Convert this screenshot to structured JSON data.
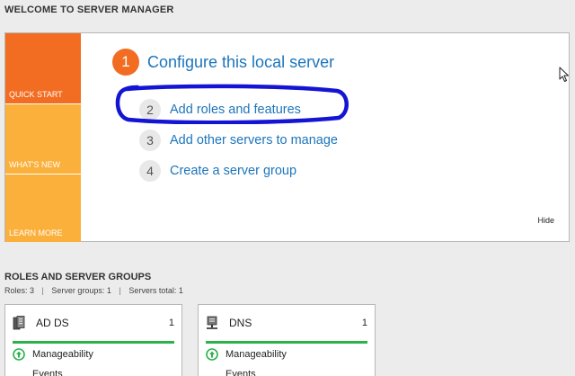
{
  "welcome": {
    "heading": "WELCOME TO SERVER MANAGER",
    "tabs": [
      {
        "label": "QUICK START",
        "active": true
      },
      {
        "label": "WHAT'S NEW",
        "active": false
      },
      {
        "label": "LEARN MORE",
        "active": false
      }
    ],
    "steps": [
      {
        "number": "1",
        "label": "Configure this local server"
      },
      {
        "number": "2",
        "label": "Add roles and features"
      },
      {
        "number": "3",
        "label": "Add other servers to manage"
      },
      {
        "number": "4",
        "label": "Create a server group"
      }
    ],
    "hide_label": "Hide"
  },
  "roles": {
    "heading": "ROLES AND SERVER GROUPS",
    "summary": {
      "roles": "Roles: 3",
      "groups": "Server groups: 1",
      "servers": "Servers total: 1",
      "separator": "|"
    },
    "cards": [
      {
        "name": "AD DS",
        "count": "1",
        "manageability": "Manageability",
        "events": "Events",
        "icon": "ad-ds-icon"
      },
      {
        "name": "DNS",
        "count": "1",
        "manageability": "Manageability",
        "events": "Events",
        "icon": "dns-icon"
      }
    ]
  },
  "colors": {
    "accent_orange": "#f26d21",
    "tab_yellow": "#fbb03b",
    "link_blue": "#1c75bc",
    "status_green": "#2bb34a",
    "annotation_blue": "#1414d4"
  }
}
